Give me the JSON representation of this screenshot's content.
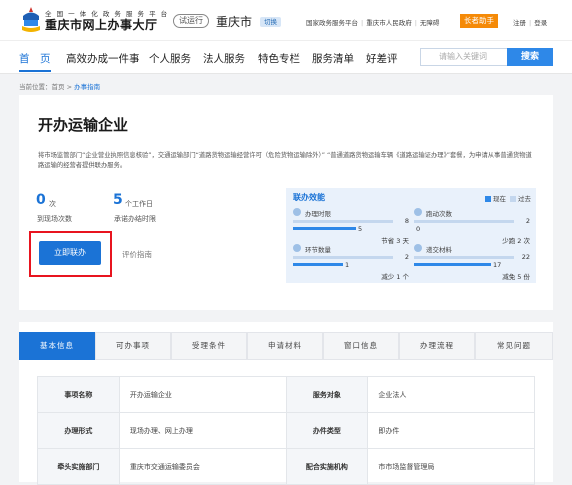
{
  "header": {
    "logo_small": "全 国 一 体 化 政 务 服 务 平 台",
    "logo_title": "重庆市网上办事大厅",
    "trial": "试运行",
    "city": "重庆市",
    "switch": "切换",
    "links": [
      "国家政务服务平台",
      "重庆市人民政府",
      "无障碍"
    ],
    "elder": "长者助手",
    "register": "注册",
    "login": "登录"
  },
  "nav": {
    "items": [
      "首　页",
      "高效办成一件事",
      "个人服务",
      "法人服务",
      "特色专栏",
      "服务清单",
      "好差评"
    ],
    "search_placeholder": "请输入关键词",
    "search_button": "搜索"
  },
  "breadcrumb": {
    "prefix": "当前位置：",
    "home": "首页",
    "sep": " > ",
    "current": "办事指南"
  },
  "item": {
    "title": "开办运输企业",
    "description": "将市场监管部门“企业营业执照信息核验”，交通运输部门“道路货物运输经营许可（危险货物运输除外）” “普通道路货物运输车辆《道路运输证办理》”套餐，为申请从事普通货物道路运输的经营者提供联办服务。",
    "stat_visits_num": "0",
    "stat_visits_unit": "次",
    "stat_visits_label": "到现场次数",
    "stat_days_num": "5",
    "stat_days_unit": "个工作日",
    "stat_days_label": "承诺办结时限",
    "apply_button": "立即联办",
    "evaluate": "评价指南"
  },
  "effect": {
    "title": "联办效能",
    "legend_now": "现在",
    "legend_past": "过去",
    "metrics": [
      {
        "label": "办理时限",
        "past": "8",
        "now": "5",
        "note": "节省 3 天",
        "icon": "clock-icon",
        "past_frac": 1.0,
        "now_frac": 0.625
      },
      {
        "label": "跑动次数",
        "past": "2",
        "now": "0",
        "note": "少跑 2 次",
        "icon": "run-icon",
        "past_frac": 1.0,
        "now_frac": 0.0
      },
      {
        "label": "环节数量",
        "past": "2",
        "now": "1",
        "note": "减少 1 个",
        "icon": "steps-icon",
        "past_frac": 1.0,
        "now_frac": 0.5
      },
      {
        "label": "递交材料",
        "past": "22",
        "now": "17",
        "note": "减免 5 份",
        "icon": "document-icon",
        "past_frac": 1.0,
        "now_frac": 0.77
      }
    ]
  },
  "tabs": [
    "基本信息",
    "可办事项",
    "受理条件",
    "申请材料",
    "窗口信息",
    "办理流程",
    "常见问题"
  ],
  "basic_info": [
    {
      "k1": "事项名称",
      "v1": "开办运输企业",
      "k2": "服务对象",
      "v2": "企业法人"
    },
    {
      "k1": "办理形式",
      "v1": "现场办理、网上办理",
      "k2": "办件类型",
      "v2": "即办件"
    },
    {
      "k1": "牵头实施部门",
      "v1": "重庆市交通运输委员会",
      "k2": "配合实施机构",
      "v2": "市市场监督管理局"
    }
  ],
  "colors": {
    "brand": "#1b73d6",
    "highlight": "#e8141f",
    "elder": "#f58a07"
  }
}
